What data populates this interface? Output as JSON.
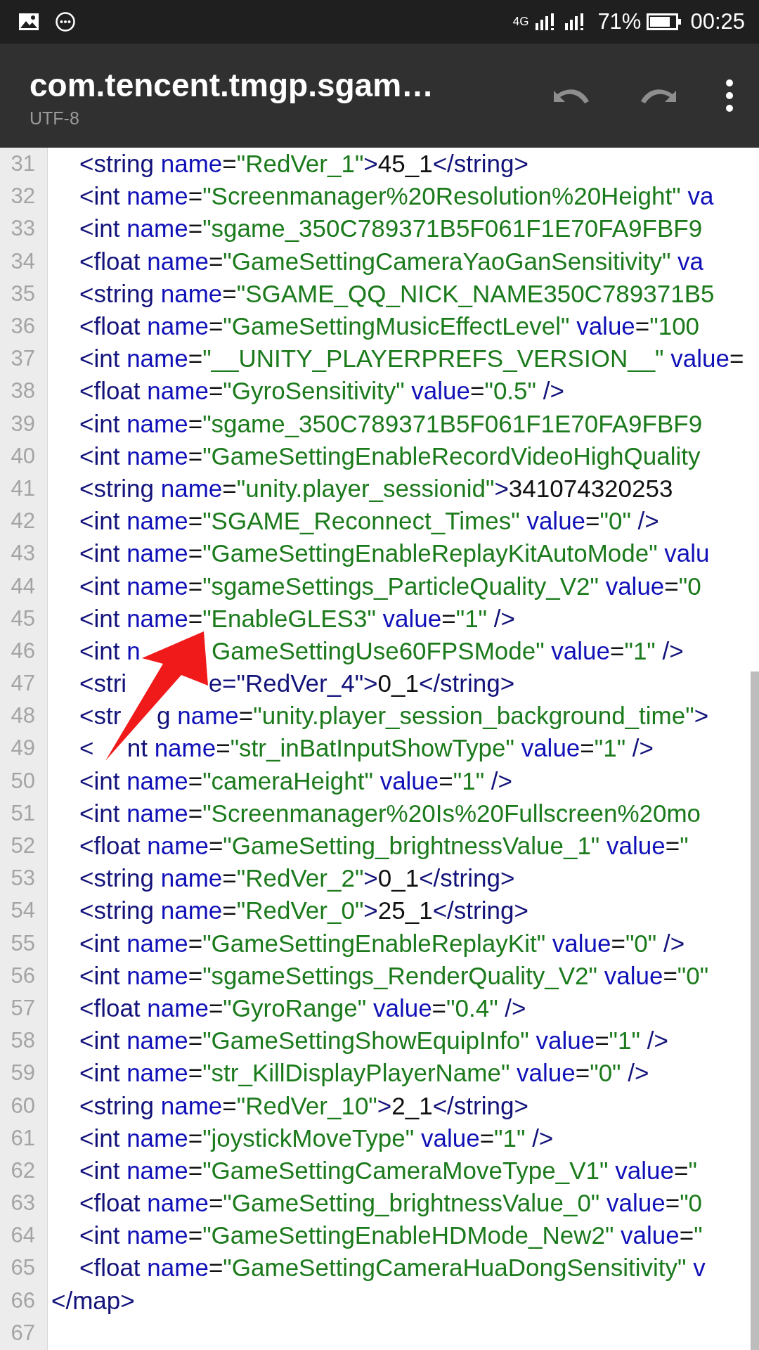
{
  "status_bar": {
    "network": "4G",
    "battery": "71%",
    "time": "00:25"
  },
  "toolbar": {
    "title": "com.tencent.tmgp.sgam…",
    "subtitle": "UTF-8"
  },
  "editor": {
    "lines": [
      {
        "children": [
          {
            "number": "31",
            "text": "<string name=\"RedVer_1\">45_1</string>"
          },
          {
            "number": "32",
            "text": "<int name=\"Screenmanager%20Resolution%20Height\" va"
          },
          {
            "number": "33",
            "text": "<int name=\"sgame_350C789371B5F061F1E70FA9FBF9"
          },
          {
            "number": "34",
            "text": "<float name=\"GameSettingCameraYaoGanSensitivity\" va"
          },
          {
            "number": "35",
            "text": "<string name=\"SGAME_QQ_NICK_NAME350C789371B5"
          },
          {
            "number": "36",
            "text": "<float name=\"GameSettingMusicEffectLevel\" value=\"100"
          },
          {
            "number": "37",
            "text": "<int name=\"__UNITY_PLAYERPREFS_VERSION__\" value="
          },
          {
            "number": "38",
            "text": "<float name=\"GyroSensitivity\" value=\"0.5\" />"
          },
          {
            "number": "39",
            "text": "<int name=\"sgame_350C789371B5F061F1E70FA9FBF9"
          },
          {
            "number": "40",
            "text": "<int name=\"GameSettingEnableRecordVideoHighQuality"
          },
          {
            "number": "41",
            "text": "<string name=\"unity.player_sessionid\">341074320253"
          },
          {
            "number": "42",
            "text": "<int name=\"SGAME_Reconnect_Times\" value=\"0\" />"
          },
          {
            "number": "43",
            "text": "<int name=\"GameSettingEnableReplayKitAutoMode\" valu"
          },
          {
            "number": "44",
            "text": "<int name=\"sgameSettings_ParticleQuality_V2\" value=\"0"
          },
          {
            "number": "45",
            "text": "<int name=\"EnableGLES3\" value=\"1\" />"
          },
          {
            "number": "46",
            "text": "<int n",
            "text_after_arrow": "GameSettingUse60FPSMode\" value=\"1\" />"
          },
          {
            "number": "47",
            "text": "<stri",
            "text_after_arrow": "e=\"RedVer_4\">0_1</string>"
          },
          {
            "number": "48",
            "text": "<str",
            "text_after_arrow": "g name=\"unity.player_session_background_time\">"
          },
          {
            "number": "49",
            "text": "<",
            "text_after_arrow": "nt name=\"str_inBatInputShowType\" value=\"1\" />"
          },
          {
            "number": "50",
            "text": "<int name=\"cameraHeight\" value=\"1\" />"
          },
          {
            "number": "51",
            "text": "<int name=\"Screenmanager%20Is%20Fullscreen%20mo"
          },
          {
            "number": "52",
            "text": "<float name=\"GameSetting_brightnessValue_1\" value=\""
          },
          {
            "number": "53",
            "text": "<string name=\"RedVer_2\">0_1</string>"
          },
          {
            "number": "54",
            "text": "<string name=\"RedVer_0\">25_1</string>"
          },
          {
            "number": "55",
            "text": "<int name=\"GameSettingEnableReplayKit\" value=\"0\" />"
          },
          {
            "number": "56",
            "text": "<int name=\"sgameSettings_RenderQuality_V2\" value=\"0\""
          },
          {
            "number": "57",
            "text": "<float name=\"GyroRange\" value=\"0.4\" />"
          },
          {
            "number": "58",
            "text": "<int name=\"GameSettingShowEquipInfo\" value=\"1\" />"
          },
          {
            "number": "59",
            "text": "<int name=\"str_KillDisplayPlayerName\" value=\"0\" />"
          },
          {
            "number": "60",
            "text": "<string name=\"RedVer_10\">2_1</string>"
          },
          {
            "number": "61",
            "text": "<int name=\"joystickMoveType\" value=\"1\" />"
          },
          {
            "number": "62",
            "text": "<int name=\"GameSettingCameraMoveType_V1\" value=\""
          },
          {
            "number": "63",
            "text": "<float name=\"GameSetting_brightnessValue_0\" value=\"0"
          },
          {
            "number": "64",
            "text": "<int name=\"GameSettingEnableHDMode_New2\" value=\""
          },
          {
            "number": "65",
            "text": "<float name=\"GameSettingCameraHuaDongSensitivity\" v"
          }
        ]
      },
      {
        "number": "66",
        "text": "</map>"
      },
      {
        "number": "67"
      }
    ]
  }
}
